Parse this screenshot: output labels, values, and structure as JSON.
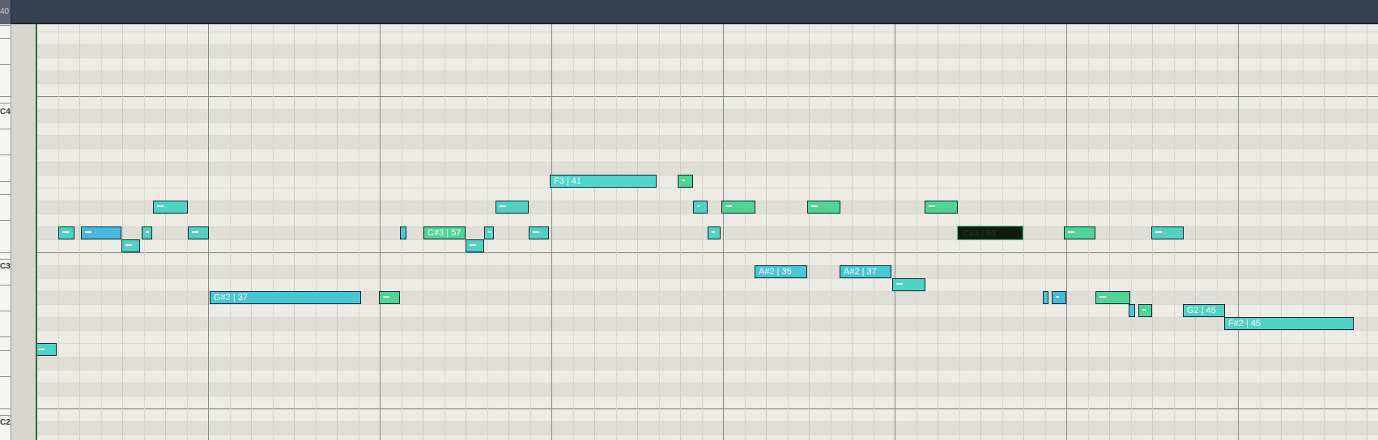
{
  "ruler": {
    "number": "40"
  },
  "octave_labels": [
    {
      "text": "C4"
    },
    {
      "text": "C3"
    },
    {
      "text": "C2"
    }
  ],
  "notes": [
    {
      "label": "",
      "color": "#4dd3c6",
      "pitch": "E2"
    },
    {
      "label": "",
      "color": "#4dd3c6",
      "pitch": "C#3"
    },
    {
      "label": "",
      "color": "#46b9e0",
      "pitch": "C#3"
    },
    {
      "label": "",
      "color": "#4dd3c6",
      "pitch": "C3"
    },
    {
      "label": "",
      "color": "#4dd3c6",
      "pitch": "C#3"
    },
    {
      "label": "",
      "color": "#4dd3c6",
      "pitch": "D#3"
    },
    {
      "label": "",
      "color": "#4dd3c6",
      "pitch": "C#3"
    },
    {
      "label": "G#2 | 37",
      "color": "#46c7d8",
      "pitch": "G#2"
    },
    {
      "label": "",
      "color": "#4bd694",
      "pitch": "G#2"
    },
    {
      "label": "",
      "color": "#46c7d8",
      "pitch": "C#3"
    },
    {
      "label": "C#3 | 57",
      "color": "#4bd694",
      "pitch": "C#3"
    },
    {
      "label": "",
      "color": "#4dd3c6",
      "pitch": "C3"
    },
    {
      "label": "",
      "color": "#4dd3c6",
      "pitch": "C#3"
    },
    {
      "label": "",
      "color": "#4dd3c6",
      "pitch": "D#3"
    },
    {
      "label": "",
      "color": "#4dd3c6",
      "pitch": "C#3"
    },
    {
      "label": "F3 | 41",
      "color": "#4dd8cf",
      "pitch": "F3"
    },
    {
      "label": "",
      "color": "#4bd694",
      "pitch": "F3"
    },
    {
      "label": "",
      "color": "#4dd3c6",
      "pitch": "D#3"
    },
    {
      "label": "",
      "color": "#4dd3c6",
      "pitch": "C#3"
    },
    {
      "label": "",
      "color": "#4bd694",
      "pitch": "D#3"
    },
    {
      "label": "A#2 | 35",
      "color": "#46c7d8",
      "pitch": "A#2"
    },
    {
      "label": "",
      "color": "#4bd694",
      "pitch": "D#3"
    },
    {
      "label": "A#2 | 37",
      "color": "#46c7d8",
      "pitch": "A#2"
    },
    {
      "label": "",
      "color": "#4dd3c6",
      "pitch": "A2"
    },
    {
      "label": "",
      "color": "#4bd694",
      "pitch": "D#3"
    },
    {
      "label": "C#3 | 53",
      "color": "#111a12",
      "pitch": "C#3",
      "selected": true
    },
    {
      "label": "",
      "color": "#46c7d8",
      "pitch": "G#2"
    },
    {
      "label": "",
      "color": "#46b9e0",
      "pitch": "G#2"
    },
    {
      "label": "",
      "color": "#4bd694",
      "pitch": "C#3"
    },
    {
      "label": "",
      "color": "#4bd694",
      "pitch": "G#2"
    },
    {
      "label": "",
      "color": "#46c7d8",
      "pitch": "G2"
    },
    {
      "label": "",
      "color": "#4bd694",
      "pitch": "G2"
    },
    {
      "label": "",
      "color": "#4dd3c6",
      "pitch": "C#3"
    },
    {
      "label": "G2 | 45",
      "color": "#4dd3c6",
      "pitch": "G2"
    },
    {
      "label": "F#2 | 45",
      "color": "#4dd3c6",
      "pitch": "F#2"
    }
  ]
}
